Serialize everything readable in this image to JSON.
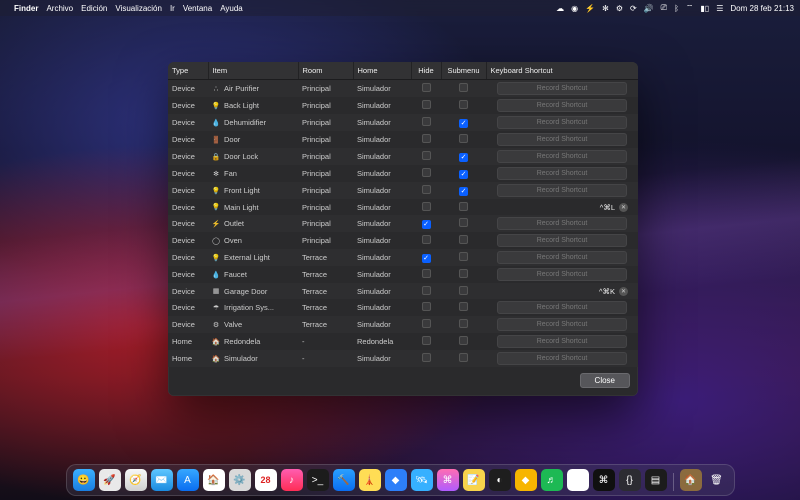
{
  "menubar": {
    "app": "Finder",
    "items": [
      "Archivo",
      "Edición",
      "Visualización",
      "Ir",
      "Ventana",
      "Ayuda"
    ],
    "status_icons": [
      "cloud",
      "spotify",
      "bolt",
      "fan",
      "gear",
      "refresh",
      "volume",
      "display",
      "bluetooth",
      "wifi",
      "battery",
      "control"
    ],
    "clock": "Dom 28 feb  21:13"
  },
  "window": {
    "headers": {
      "type": "Type",
      "item": "Item",
      "room": "Room",
      "home": "Home",
      "hide": "Hide",
      "submenu": "Submenu",
      "shortcut": "Keyboard Shortcut"
    },
    "record_label": "Record Shortcut",
    "close_label": "Close",
    "rows": [
      {
        "type": "Device",
        "icon": "∴",
        "item": "Air Purifier",
        "room": "Principal",
        "home": "Simulador",
        "hide": false,
        "submenu": false,
        "shortcut": null
      },
      {
        "type": "Device",
        "icon": "💡",
        "item": "Back Light",
        "room": "Principal",
        "home": "Simulador",
        "hide": false,
        "submenu": false,
        "shortcut": null
      },
      {
        "type": "Device",
        "icon": "💧",
        "item": "Dehumidifier",
        "room": "Principal",
        "home": "Simulador",
        "hide": false,
        "submenu": true,
        "shortcut": null
      },
      {
        "type": "Device",
        "icon": "🚪",
        "item": "Door",
        "room": "Principal",
        "home": "Simulador",
        "hide": false,
        "submenu": false,
        "shortcut": null
      },
      {
        "type": "Device",
        "icon": "🔒",
        "item": "Door Lock",
        "room": "Principal",
        "home": "Simulador",
        "hide": false,
        "submenu": true,
        "shortcut": null
      },
      {
        "type": "Device",
        "icon": "✻",
        "item": "Fan",
        "room": "Principal",
        "home": "Simulador",
        "hide": false,
        "submenu": true,
        "shortcut": null
      },
      {
        "type": "Device",
        "icon": "💡",
        "item": "Front Light",
        "room": "Principal",
        "home": "Simulador",
        "hide": false,
        "submenu": true,
        "shortcut": null
      },
      {
        "type": "Device",
        "icon": "💡",
        "item": "Main Light",
        "room": "Principal",
        "home": "Simulador",
        "hide": false,
        "submenu": false,
        "shortcut": "^⌘L"
      },
      {
        "type": "Device",
        "icon": "⚡",
        "item": "Outlet",
        "room": "Principal",
        "home": "Simulador",
        "hide": true,
        "submenu": false,
        "shortcut": null
      },
      {
        "type": "Device",
        "icon": "◯",
        "item": "Oven",
        "room": "Principal",
        "home": "Simulador",
        "hide": false,
        "submenu": false,
        "shortcut": null
      },
      {
        "type": "Device",
        "icon": "💡",
        "item": "External Light",
        "room": "Terrace",
        "home": "Simulador",
        "hide": true,
        "submenu": false,
        "shortcut": null
      },
      {
        "type": "Device",
        "icon": "💧",
        "item": "Faucet",
        "room": "Terrace",
        "home": "Simulador",
        "hide": false,
        "submenu": false,
        "shortcut": null
      },
      {
        "type": "Device",
        "icon": "▦",
        "item": "Garage Door",
        "room": "Terrace",
        "home": "Simulador",
        "hide": false,
        "submenu": false,
        "shortcut": "^⌘K"
      },
      {
        "type": "Device",
        "icon": "☂",
        "item": "Irrigation Sys...",
        "room": "Terrace",
        "home": "Simulador",
        "hide": false,
        "submenu": false,
        "shortcut": null
      },
      {
        "type": "Device",
        "icon": "⚙",
        "item": "Valve",
        "room": "Terrace",
        "home": "Simulador",
        "hide": false,
        "submenu": false,
        "shortcut": null
      },
      {
        "type": "Home",
        "icon": "🏠",
        "item": "Redondela",
        "room": "-",
        "home": "Redondela",
        "hide": false,
        "submenu": false,
        "shortcut": null
      },
      {
        "type": "Home",
        "icon": "🏠",
        "item": "Simulador",
        "room": "-",
        "home": "Simulador",
        "hide": false,
        "submenu": false,
        "shortcut": null
      }
    ]
  },
  "dock": {
    "apps": [
      {
        "name": "Finder",
        "bg": "linear-gradient(#3bb0ff,#1a7ee0)",
        "glyph": "😀"
      },
      {
        "name": "Launchpad",
        "bg": "#e9e9e9",
        "glyph": "🚀"
      },
      {
        "name": "Safari",
        "bg": "linear-gradient(#f7f7f7,#d0d0d0)",
        "glyph": "🧭"
      },
      {
        "name": "Mail",
        "bg": "linear-gradient(#5ec6ff,#1a8be0)",
        "glyph": "✉️"
      },
      {
        "name": "App Store",
        "bg": "linear-gradient(#36a7ff,#0a6df0)",
        "glyph": "A"
      },
      {
        "name": "Home",
        "bg": "#ffffff",
        "glyph": "🏠"
      },
      {
        "name": "Settings",
        "bg": "#d9d9d9",
        "glyph": "⚙️"
      },
      {
        "name": "Calendar",
        "bg": "#ffffff",
        "glyph": "28"
      },
      {
        "name": "Music",
        "bg": "linear-gradient(#ff5db1,#ff2d55)",
        "glyph": "♪"
      },
      {
        "name": "Terminal",
        "bg": "#1c1c1c",
        "glyph": ">_"
      },
      {
        "name": "Xcode",
        "bg": "linear-gradient(#2aa0ff,#0a6df0)",
        "glyph": "🔨"
      },
      {
        "name": "Tower",
        "bg": "#ffdd55",
        "glyph": "🗼"
      },
      {
        "name": "SourceTree",
        "bg": "#2d7ff9",
        "glyph": "◆"
      },
      {
        "name": "Proxyman",
        "bg": "#36b0ff",
        "glyph": "🛰"
      },
      {
        "name": "Shortcuts",
        "bg": "linear-gradient(#ff6db3,#b05cff)",
        "glyph": "⌘"
      },
      {
        "name": "Notes",
        "bg": "#f8d34c",
        "glyph": "📝"
      },
      {
        "name": "Figma",
        "bg": "#1e1e1e",
        "glyph": "◐"
      },
      {
        "name": "Sketch",
        "bg": "#f7b500",
        "glyph": "◆"
      },
      {
        "name": "Spotify",
        "bg": "#1db954",
        "glyph": "♬"
      },
      {
        "name": "Slack",
        "bg": "#ffffff",
        "glyph": "✳"
      },
      {
        "name": "iTerm",
        "bg": "#101010",
        "glyph": "⌘"
      },
      {
        "name": "VSCode",
        "bg": "#2c2c32",
        "glyph": "{}"
      },
      {
        "name": "Console",
        "bg": "#1c1c1c",
        "glyph": "▤"
      }
    ],
    "right": [
      {
        "name": "HomeControl",
        "bg": "#8b6b3e",
        "glyph": "🏠"
      },
      {
        "name": "Trash",
        "bg": "transparent",
        "glyph": "🗑"
      }
    ]
  }
}
